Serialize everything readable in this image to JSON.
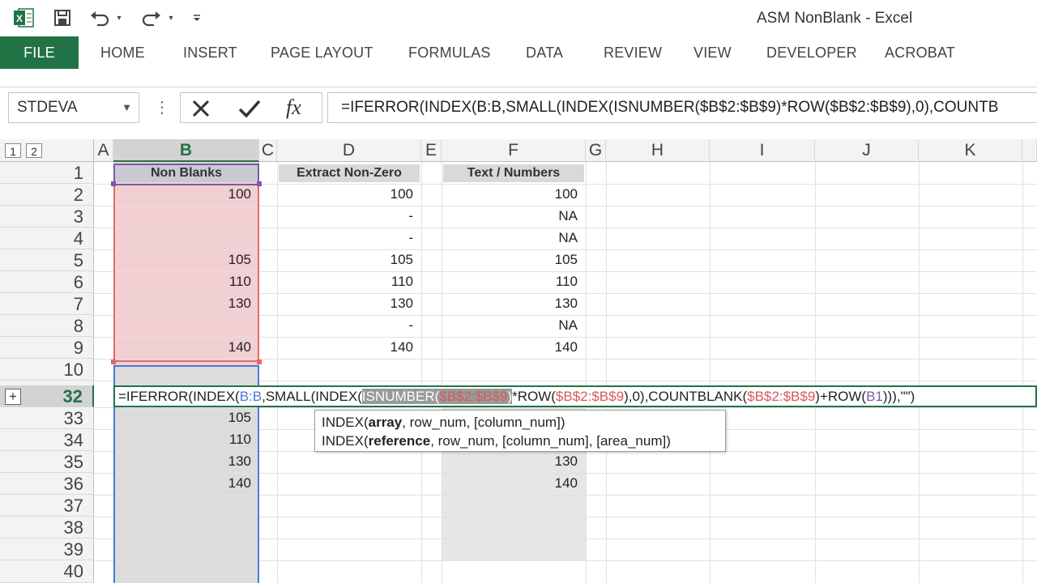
{
  "app": {
    "title": "ASM NonBlank - Excel"
  },
  "quick_access": {
    "excel_icon": "X",
    "save_icon": "save-icon",
    "undo_icon": "undo-icon",
    "redo_icon": "redo-icon",
    "customize_icon": "customize-icon"
  },
  "tabs": [
    {
      "label": "FILE"
    },
    {
      "label": "HOME"
    },
    {
      "label": "INSERT"
    },
    {
      "label": "PAGE LAYOUT"
    },
    {
      "label": "FORMULAS"
    },
    {
      "label": "DATA"
    },
    {
      "label": "REVIEW"
    },
    {
      "label": "VIEW"
    },
    {
      "label": "DEVELOPER"
    },
    {
      "label": "ACROBAT"
    }
  ],
  "namebox": {
    "value": "STDEVA"
  },
  "formula_bar": {
    "value": "=IFERROR(INDEX(B:B,SMALL(INDEX(ISNUMBER($B$2:$B$9)*ROW($B$2:$B$9),0),COUNTB"
  },
  "outline": {
    "level1": "1",
    "level2": "2",
    "expand": "+"
  },
  "columns": [
    "A",
    "B",
    "C",
    "D",
    "E",
    "F",
    "G",
    "H",
    "I",
    "J",
    "K"
  ],
  "rows": [
    "1",
    "2",
    "3",
    "4",
    "5",
    "6",
    "7",
    "8",
    "9",
    "10",
    "32",
    "33",
    "34",
    "35",
    "36",
    "37",
    "38",
    "39",
    "40"
  ],
  "headers": {
    "b1": "Non Blanks",
    "d1": "Extract Non-Zero",
    "f1": "Text / Numbers"
  },
  "col_b": [
    "100",
    "",
    "",
    "105",
    "110",
    "130",
    "",
    "140"
  ],
  "col_d": [
    "100",
    "-",
    "-",
    "105",
    "110",
    "130",
    "-",
    "140"
  ],
  "col_f": [
    "100",
    "NA",
    "NA",
    "105",
    "110",
    "130",
    "NA",
    "140"
  ],
  "lower_b": [
    "105",
    "110",
    "130",
    "140"
  ],
  "lower_f": [
    "130",
    "140"
  ],
  "edit_formula": {
    "p1": "=IFERROR(INDEX(",
    "p2": "B:B",
    "p3": ",SMALL(INDEX(",
    "p4": "ISNUMBER(",
    "p5": "$B$2:$B$9",
    "p6": ")",
    "p7": "*ROW(",
    "p8": "$B$2:$B$9",
    "p9": "),0),COUNTBLANK(",
    "p10": "$B$2:$B$9",
    "p11": ")+ROW(",
    "p12": "B1",
    "p13": "))),\"\")"
  },
  "tooltip": {
    "line1_fn": "INDEX(",
    "line1_arg": "array",
    "line1_rest": ", row_num, [column_num])",
    "line2_fn": "INDEX(",
    "line2_arg": "reference",
    "line2_rest": ", row_num, [column_num], [area_num])"
  },
  "colors": {
    "excel_green": "#217346",
    "range_red": "#f2cfd3",
    "selection_gray": "#dcdcdc"
  }
}
